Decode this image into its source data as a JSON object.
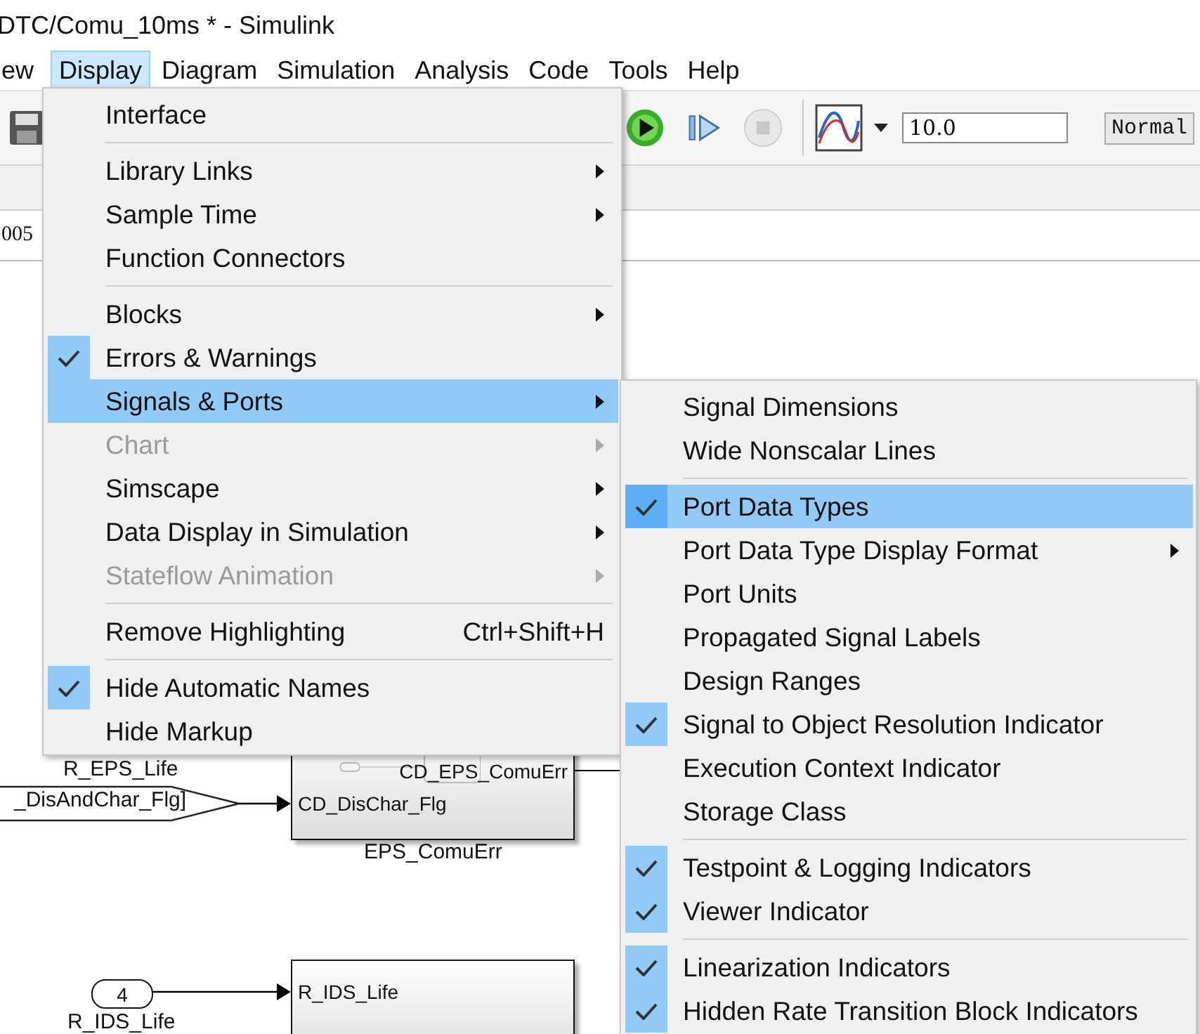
{
  "window": {
    "title": "DTC/Comu_10ms * - Simulink"
  },
  "menu_bar": [
    {
      "label": "ew",
      "selected": false
    },
    {
      "label": "Display",
      "selected": true
    },
    {
      "label": "Diagram",
      "selected": false
    },
    {
      "label": "Simulation",
      "selected": false
    },
    {
      "label": "Analysis",
      "selected": false
    },
    {
      "label": "Code",
      "selected": false
    },
    {
      "label": "Tools",
      "selected": false
    },
    {
      "label": "Help",
      "selected": false
    }
  ],
  "toolbar": {
    "stop_time": "10.0",
    "sim_mode": "Normal"
  },
  "address_bar": {
    "text": "005"
  },
  "display_menu": [
    {
      "kind": "item",
      "label": "Interface",
      "checked": false,
      "disabled": false,
      "submenu": false,
      "selected": false
    },
    {
      "kind": "separator"
    },
    {
      "kind": "item",
      "label": "Library Links",
      "checked": false,
      "disabled": false,
      "submenu": true,
      "selected": false
    },
    {
      "kind": "item",
      "label": "Sample Time",
      "checked": false,
      "disabled": false,
      "submenu": true,
      "selected": false
    },
    {
      "kind": "item",
      "label": "Function Connectors",
      "checked": false,
      "disabled": false,
      "submenu": false,
      "selected": false
    },
    {
      "kind": "separator"
    },
    {
      "kind": "item",
      "label": "Blocks",
      "checked": false,
      "disabled": false,
      "submenu": true,
      "selected": false
    },
    {
      "kind": "item",
      "label": "Errors & Warnings",
      "checked": true,
      "disabled": false,
      "submenu": false,
      "selected": false
    },
    {
      "kind": "item",
      "label": "Signals & Ports",
      "checked": false,
      "disabled": false,
      "submenu": true,
      "selected": true
    },
    {
      "kind": "item",
      "label": "Chart",
      "checked": false,
      "disabled": true,
      "submenu": true,
      "selected": false
    },
    {
      "kind": "item",
      "label": "Simscape",
      "checked": false,
      "disabled": false,
      "submenu": true,
      "selected": false
    },
    {
      "kind": "item",
      "label": "Data Display in Simulation",
      "checked": false,
      "disabled": false,
      "submenu": true,
      "selected": false
    },
    {
      "kind": "item",
      "label": "Stateflow Animation",
      "checked": false,
      "disabled": true,
      "submenu": true,
      "selected": false
    },
    {
      "kind": "separator"
    },
    {
      "kind": "item",
      "label": "Remove Highlighting",
      "shortcut": "Ctrl+Shift+H",
      "checked": false,
      "disabled": false,
      "submenu": false,
      "selected": false
    },
    {
      "kind": "separator"
    },
    {
      "kind": "item",
      "label": "Hide Automatic Names",
      "checked": true,
      "disabled": false,
      "submenu": false,
      "selected": false
    },
    {
      "kind": "item",
      "label": "Hide Markup",
      "checked": false,
      "disabled": false,
      "submenu": false,
      "selected": false
    }
  ],
  "signals_submenu": [
    {
      "kind": "item",
      "label": "Signal Dimensions",
      "checked": false,
      "disabled": false,
      "submenu": false,
      "selected": false
    },
    {
      "kind": "item",
      "label": "Wide Nonscalar Lines",
      "checked": false,
      "disabled": false,
      "submenu": false,
      "selected": false
    },
    {
      "kind": "separator"
    },
    {
      "kind": "item",
      "label": "Port Data Types",
      "checked": true,
      "disabled": false,
      "submenu": false,
      "selected": true
    },
    {
      "kind": "item",
      "label": "Port Data Type Display Format",
      "checked": false,
      "disabled": false,
      "submenu": true,
      "selected": false
    },
    {
      "kind": "item",
      "label": "Port Units",
      "checked": false,
      "disabled": false,
      "submenu": false,
      "selected": false
    },
    {
      "kind": "item",
      "label": "Propagated Signal Labels",
      "checked": false,
      "disabled": false,
      "submenu": false,
      "selected": false
    },
    {
      "kind": "item",
      "label": "Design Ranges",
      "checked": false,
      "disabled": false,
      "submenu": false,
      "selected": false
    },
    {
      "kind": "item",
      "label": "Signal to Object Resolution Indicator",
      "checked": true,
      "disabled": false,
      "submenu": false,
      "selected": false
    },
    {
      "kind": "item",
      "label": "Execution Context Indicator",
      "checked": false,
      "disabled": false,
      "submenu": false,
      "selected": false
    },
    {
      "kind": "item",
      "label": "Storage Class",
      "checked": false,
      "disabled": false,
      "submenu": false,
      "selected": false
    },
    {
      "kind": "separator"
    },
    {
      "kind": "item",
      "label": "Testpoint & Logging Indicators",
      "checked": true,
      "disabled": false,
      "submenu": false,
      "selected": false
    },
    {
      "kind": "item",
      "label": "Viewer Indicator",
      "checked": true,
      "disabled": false,
      "submenu": false,
      "selected": false
    },
    {
      "kind": "separator"
    },
    {
      "kind": "item",
      "label": "Linearization Indicators",
      "checked": true,
      "disabled": false,
      "submenu": false,
      "selected": false
    },
    {
      "kind": "item",
      "label": "Hidden Rate Transition Block Indicators",
      "checked": true,
      "disabled": false,
      "submenu": false,
      "selected": false
    }
  ],
  "diagram": {
    "eps_inport_label": "R_EPS_Life",
    "eps_output_port": "CD_EPS_ComuErr",
    "goto_tag": "_DisAndChar_Flg]",
    "eps_input_port": "CD_DisChar_Flg",
    "eps_block_name": "EPS_ComuErr",
    "ids_inport_number": "4",
    "ids_inport_label": "R_IDS_Life",
    "ids_input_port": "R_IDS_Life"
  }
}
